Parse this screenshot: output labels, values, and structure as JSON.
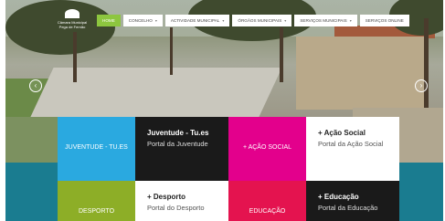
{
  "logo": {
    "line1": "Câmara Municipal",
    "line2": "Pega de Fernão"
  },
  "nav": [
    {
      "label": "HOME",
      "caret": ""
    },
    {
      "label": "CONCELHO",
      "caret": "▾"
    },
    {
      "label": "ACTIVIDADE MUNICIPAL",
      "caret": "▾"
    },
    {
      "label": "ÓRGÃOS MUNICIPAIS",
      "caret": "▾"
    },
    {
      "label": "SERVIÇOS MUNICIPAIS",
      "caret": "▾"
    },
    {
      "label": "SERVIÇOS ONLINE",
      "caret": ""
    }
  ],
  "slider": {
    "prev_icon": "‹",
    "next_icon": "›"
  },
  "tiles": {
    "juventude": "JUVENTUDE - TU.ES",
    "juventude_title": "Juventude - Tu.es",
    "juventude_sub": "Portal da Juventude",
    "acao": "+ AÇÃO SOCIAL",
    "acao_title": "+ Ação Social",
    "acao_sub": "Portal da Ação Social",
    "desporto": "DESPORTO",
    "desporto_title": "+ Desporto",
    "desporto_sub": "Portal do Desporto",
    "educacao": "EDUCAÇÃO",
    "educacao_title": "+ Educação",
    "educacao_sub": "Portal da Educação"
  },
  "colors": {
    "blue": "#2aa9e0",
    "black": "#1a1a1a",
    "magenta": "#e3008c",
    "olive": "#8dae27",
    "crimson": "#e4134f",
    "white": "#ffffff"
  }
}
